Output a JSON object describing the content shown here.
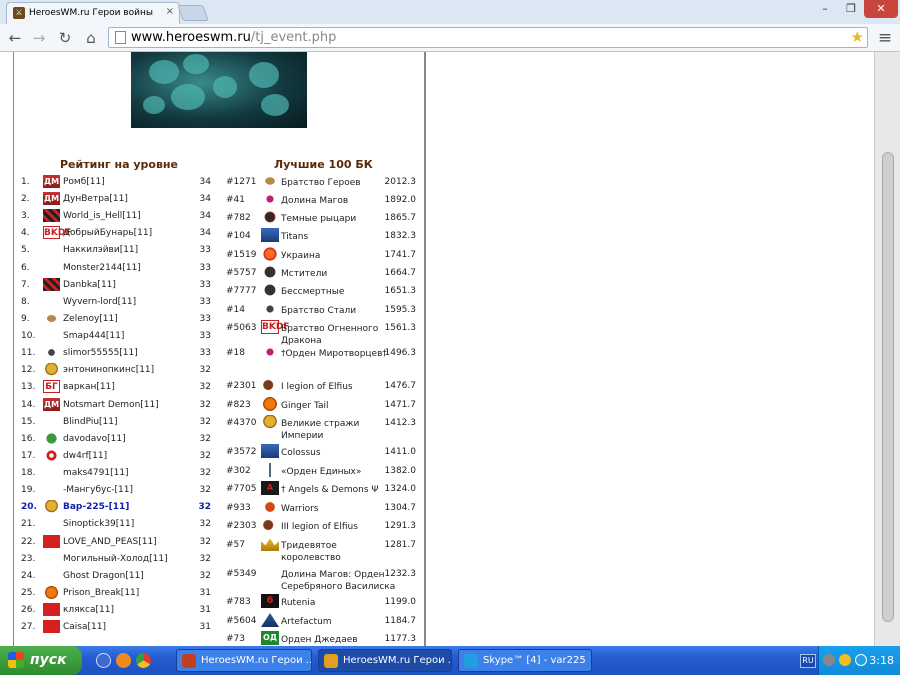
{
  "browser": {
    "tab_title": "HeroesWM.ru Герои войны",
    "tab_close": "×",
    "url_host": "www.heroeswm.ru",
    "url_path": "/tj_event.php",
    "window_min": "–",
    "window_max": "❐",
    "window_close": "✕",
    "back": "←",
    "forward": "→",
    "reload": "↻",
    "home": "⌂",
    "star": "★",
    "menu": "≡"
  },
  "rating": {
    "heading": "Рейтинг на уровне",
    "rows": [
      {
        "rank": "1.",
        "icon": "ic-dm",
        "tag": "ДМ",
        "name": "Ромб[11]",
        "level": "34"
      },
      {
        "rank": "2.",
        "icon": "ic-dm",
        "tag": "ДМ",
        "name": "ДунВетра[11]",
        "level": "34"
      },
      {
        "rank": "3.",
        "icon": "ic-check",
        "tag": "",
        "name": "World_is_Hell[11]",
        "level": "34"
      },
      {
        "rank": "4.",
        "icon": "ic-bk",
        "tag": "BKDF",
        "name": "ДобрыйБунарь[11]",
        "level": "34"
      },
      {
        "rank": "5.",
        "icon": "",
        "tag": "",
        "name": "Наккилэйви[11]",
        "level": "33"
      },
      {
        "rank": "6.",
        "icon": "",
        "tag": "",
        "name": "Monster2144[11]",
        "level": "33"
      },
      {
        "rank": "7.",
        "icon": "ic-check",
        "tag": "",
        "name": "Danbka[11]",
        "level": "33"
      },
      {
        "rank": "8.",
        "icon": "",
        "tag": "",
        "name": "Wyvern-lord[11]",
        "level": "33"
      },
      {
        "rank": "9.",
        "icon": "ic-wing",
        "tag": "",
        "name": "Zelenoy[11]",
        "level": "33"
      },
      {
        "rank": "10.",
        "icon": "",
        "tag": "",
        "name": "Smap444[11]",
        "level": "33"
      },
      {
        "rank": "11.",
        "icon": "ic-bird",
        "tag": "",
        "name": "slimor55555[11]",
        "level": "33"
      },
      {
        "rank": "12.",
        "icon": "ic-shield",
        "tag": "",
        "name": "энтонинопкинс[11]",
        "level": "32"
      },
      {
        "rank": "13.",
        "icon": "ic-bk",
        "tag": "БГ",
        "name": "варкан[11]",
        "level": "32"
      },
      {
        "rank": "14.",
        "icon": "ic-dm",
        "tag": "ДМ",
        "name": "Notsmart Demon[11]",
        "level": "32"
      },
      {
        "rank": "15.",
        "icon": "",
        "tag": "",
        "name": "BlindPiu[11]",
        "level": "32"
      },
      {
        "rank": "16.",
        "icon": "ic-leaf",
        "tag": "",
        "name": "davodavo[11]",
        "level": "32"
      },
      {
        "rank": "17.",
        "icon": "ic-target",
        "tag": "",
        "name": "dw4rf[11]",
        "level": "32"
      },
      {
        "rank": "18.",
        "icon": "",
        "tag": "",
        "name": "maks4791[11]",
        "level": "32"
      },
      {
        "rank": "19.",
        "icon": "",
        "tag": "",
        "name": "-Мангубус-[11]",
        "level": "32"
      },
      {
        "rank": "20.",
        "icon": "ic-shield",
        "tag": "",
        "name": "Вар-225-[11]",
        "level": "32",
        "me": true
      },
      {
        "rank": "21.",
        "icon": "",
        "tag": "",
        "name": "Sinoptick39[11]",
        "level": "32"
      },
      {
        "rank": "22.",
        "icon": "ic-red",
        "tag": "",
        "name": "LOVE_AND_PEAS[11]",
        "level": "32"
      },
      {
        "rank": "23.",
        "icon": "",
        "tag": "",
        "name": "Могильный-Холод[11]",
        "level": "32"
      },
      {
        "rank": "24.",
        "icon": "",
        "tag": "",
        "name": "Ghost Dragon[11]",
        "level": "32"
      },
      {
        "rank": "25.",
        "icon": "ic-orange",
        "tag": "",
        "name": "Prison_Break[11]",
        "level": "31"
      },
      {
        "rank": "26.",
        "icon": "ic-red",
        "tag": "",
        "name": "клякса[11]",
        "level": "31"
      },
      {
        "rank": "27.",
        "icon": "ic-red",
        "tag": "",
        "name": "Caisa[11]",
        "level": "31"
      }
    ]
  },
  "clans": {
    "heading": "Лучшие 100 БК",
    "rows": [
      {
        "id": "#1271",
        "icon": "ic-wing",
        "tag": "",
        "name": "Братство Героев",
        "score": "2012.3"
      },
      {
        "id": "#41",
        "icon": "ic-cross",
        "tag": "",
        "name": "Долина Магов",
        "score": "1892.0"
      },
      {
        "id": "#782",
        "icon": "ic-knight",
        "tag": "",
        "name": "Темные рыцари",
        "score": "1865.7"
      },
      {
        "id": "#104",
        "icon": "ic-blue",
        "tag": "",
        "name": "Titans",
        "score": "1832.3"
      },
      {
        "id": "#1519",
        "icon": "ic-fire",
        "tag": "",
        "name": "Украина",
        "score": "1741.7"
      },
      {
        "id": "#5757",
        "icon": "ic-dark",
        "tag": "",
        "name": "Мстители",
        "score": "1664.7"
      },
      {
        "id": "#7777",
        "icon": "ic-dark",
        "tag": "",
        "name": "Бессмертные",
        "score": "1651.3"
      },
      {
        "id": "#14",
        "icon": "ic-bird",
        "tag": "",
        "name": "Братство Стали",
        "score": "1595.3"
      },
      {
        "id": "#5063",
        "icon": "ic-bk",
        "tag": "BKDF",
        "name": "Братство Огненного Дракона",
        "score": "1561.3"
      },
      {
        "id": "#18",
        "icon": "ic-cross",
        "tag": "",
        "name": "†Орден Миротворцев†",
        "score": "1496.3"
      },
      {
        "id": "#2301",
        "icon": "ic-dragon",
        "tag": "",
        "name": "I legion of Elfius",
        "score": "1476.7"
      },
      {
        "id": "#823",
        "icon": "ic-orange",
        "tag": "",
        "name": "Ginger Tail",
        "score": "1471.7"
      },
      {
        "id": "#4370",
        "icon": "ic-shield",
        "tag": "",
        "name": "Великие стражи Империи",
        "score": "1412.3"
      },
      {
        "id": "#3572",
        "icon": "ic-blue",
        "tag": "",
        "name": "Colossus",
        "score": "1411.0"
      },
      {
        "id": "#302",
        "icon": "ic-sword",
        "tag": "",
        "name": "«Орден Единых»",
        "score": "1382.0"
      },
      {
        "id": "#7705",
        "icon": "ic-ad",
        "tag": "A",
        "name": "† Angels & Demons Ψ",
        "score": "1324.0"
      },
      {
        "id": "#933",
        "icon": "ic-w",
        "tag": "",
        "name": "Warriors",
        "score": "1304.7"
      },
      {
        "id": "#2303",
        "icon": "ic-dragon",
        "tag": "",
        "name": "III legion of Elfius",
        "score": "1291.3"
      },
      {
        "id": "#57",
        "icon": "ic-crown",
        "tag": "",
        "name": "Тридевятое королевство",
        "score": "1281.7"
      },
      {
        "id": "#5349",
        "icon": "",
        "tag": "",
        "name": "Долина Магов: Орден Серебряного Василиска",
        "score": "1232.3"
      },
      {
        "id": "#783",
        "icon": "ic-six",
        "tag": "6",
        "name": "Rutenia",
        "score": "1199.0"
      },
      {
        "id": "#5604",
        "icon": "ic-tri",
        "tag": "",
        "name": "Artefactum",
        "score": "1184.7"
      },
      {
        "id": "#73",
        "icon": "ic-green",
        "tag": "ОД",
        "name": "Орден Джедаев",
        "score": "1177.3"
      }
    ]
  },
  "taskbar": {
    "start_label": "пуск",
    "tasks": [
      {
        "label": "HeroesWM.ru Герои ...",
        "color": "#c04020"
      },
      {
        "label": "HeroesWM.ru Герои ...",
        "color": "#e0a020"
      },
      {
        "label": "Skype™ [4] - var225",
        "color": "#20a0e0"
      }
    ],
    "lang": "RU",
    "clock": "3:18"
  },
  "colors": {
    "heading": "#5a2a0a",
    "highlight_player": "#1020b0",
    "taskbar": "#245cd0",
    "start_button": "#2e8a2e"
  }
}
